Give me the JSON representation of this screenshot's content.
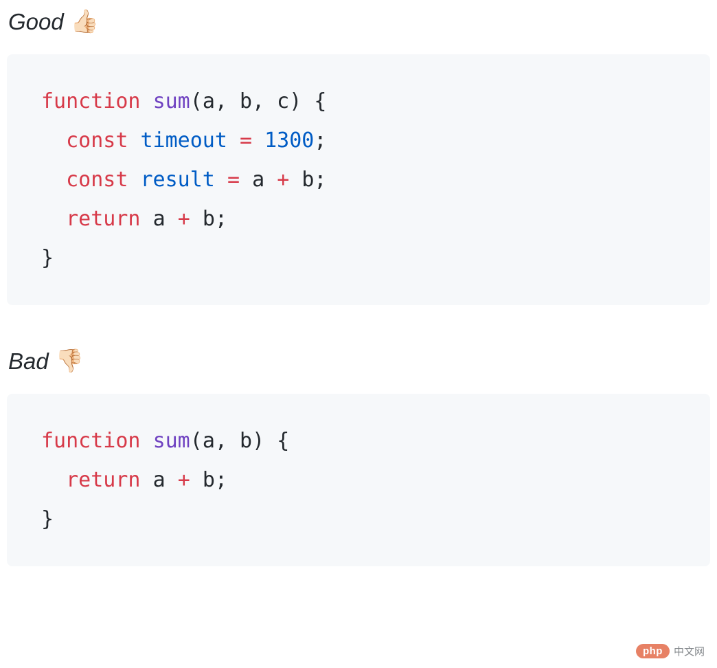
{
  "sections": [
    {
      "title": "Good",
      "emoji": "👍🏻",
      "code": {
        "keyword_function": "function",
        "func_name": "sum",
        "params": "a, b, c",
        "lines": [
          {
            "indent": "  ",
            "keyword": "const",
            "ident": "timeout",
            "eq": "=",
            "rhs_num": "1300",
            "semi": ";"
          },
          {
            "indent": "  ",
            "keyword": "const",
            "ident": "result",
            "eq": "=",
            "rhs_expr_a": "a",
            "rhs_op": "+",
            "rhs_expr_b": "b",
            "semi": ";"
          },
          {
            "indent": "  ",
            "keyword": "return",
            "expr_a": "a",
            "op": "+",
            "expr_b": "b",
            "semi": ";"
          }
        ],
        "open_brace": "{",
        "close_brace": "}"
      }
    },
    {
      "title": "Bad",
      "emoji": "👎🏻",
      "code": {
        "keyword_function": "function",
        "func_name": "sum",
        "params": "a, b",
        "lines": [
          {
            "indent": "  ",
            "keyword": "return",
            "expr_a": "a",
            "op": "+",
            "expr_b": "b",
            "semi": ";"
          }
        ],
        "open_brace": "{",
        "close_brace": "}"
      }
    }
  ],
  "watermark": {
    "pill": "php",
    "text": "中文网"
  }
}
